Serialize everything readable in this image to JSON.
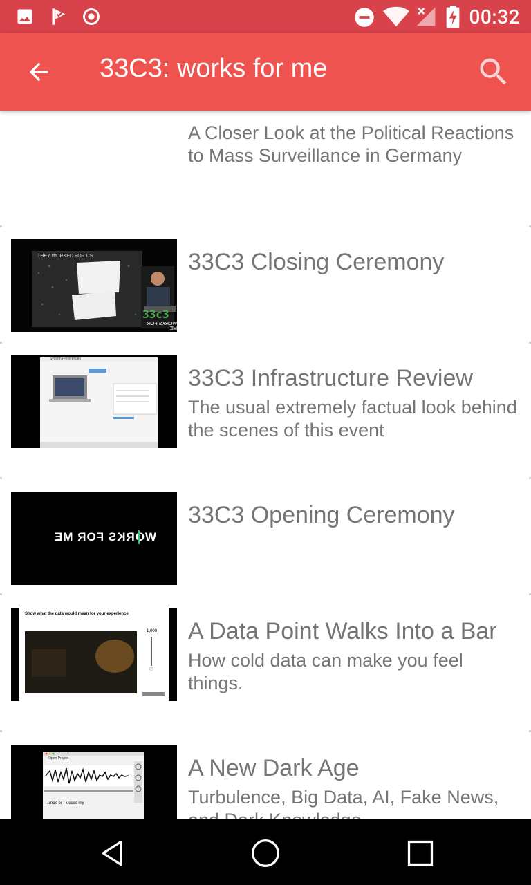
{
  "status_bar": {
    "time": "00:32",
    "left_icons": [
      "image-icon",
      "check-flag-icon",
      "record-icon"
    ],
    "right_icons": [
      "dnd-icon",
      "wifi-icon",
      "signal-off-icon",
      "battery-charging-icon"
    ]
  },
  "app_bar": {
    "title": "33C3: works for me",
    "back_icon": "arrow-back-icon",
    "search_icon": "search-icon",
    "color": "#ef5350",
    "status_color": "#d8424a"
  },
  "items": [
    {
      "title": "",
      "subtitle": "A Closer Look at the Political Reactions to Mass Surveillance in Germany"
    },
    {
      "title": "33C3 Closing Ceremony",
      "subtitle": "",
      "thumb_text_1": "THEY WORKED FOR US",
      "thumb_text_2": "33c3",
      "thumb_text_3": "WORKS FOR ME"
    },
    {
      "title": "33C3 Infrastructure Review",
      "subtitle": "The usual extremely factual look behind the scenes of this event",
      "thumb_text_1": "System Preferences"
    },
    {
      "title": "33C3 Opening Ceremony",
      "subtitle": "",
      "thumb_text_1": "WORKS FOR ME"
    },
    {
      "title": "A Data Point Walks Into a Bar",
      "subtitle": "How cold data can make you feel things.",
      "thumb_text_1": "Show what the data would mean for your experience",
      "thumb_text_2": "1,000"
    },
    {
      "title": "A New Dark Age",
      "subtitle": "Turbulence, Big Data, AI, Fake News, and Dark Knowledge",
      "thumb_text_1": "Open Project"
    }
  ],
  "nav_bar": {
    "back_icon": "nav-back-icon",
    "home_icon": "nav-home-icon",
    "recents_icon": "nav-recents-icon"
  }
}
